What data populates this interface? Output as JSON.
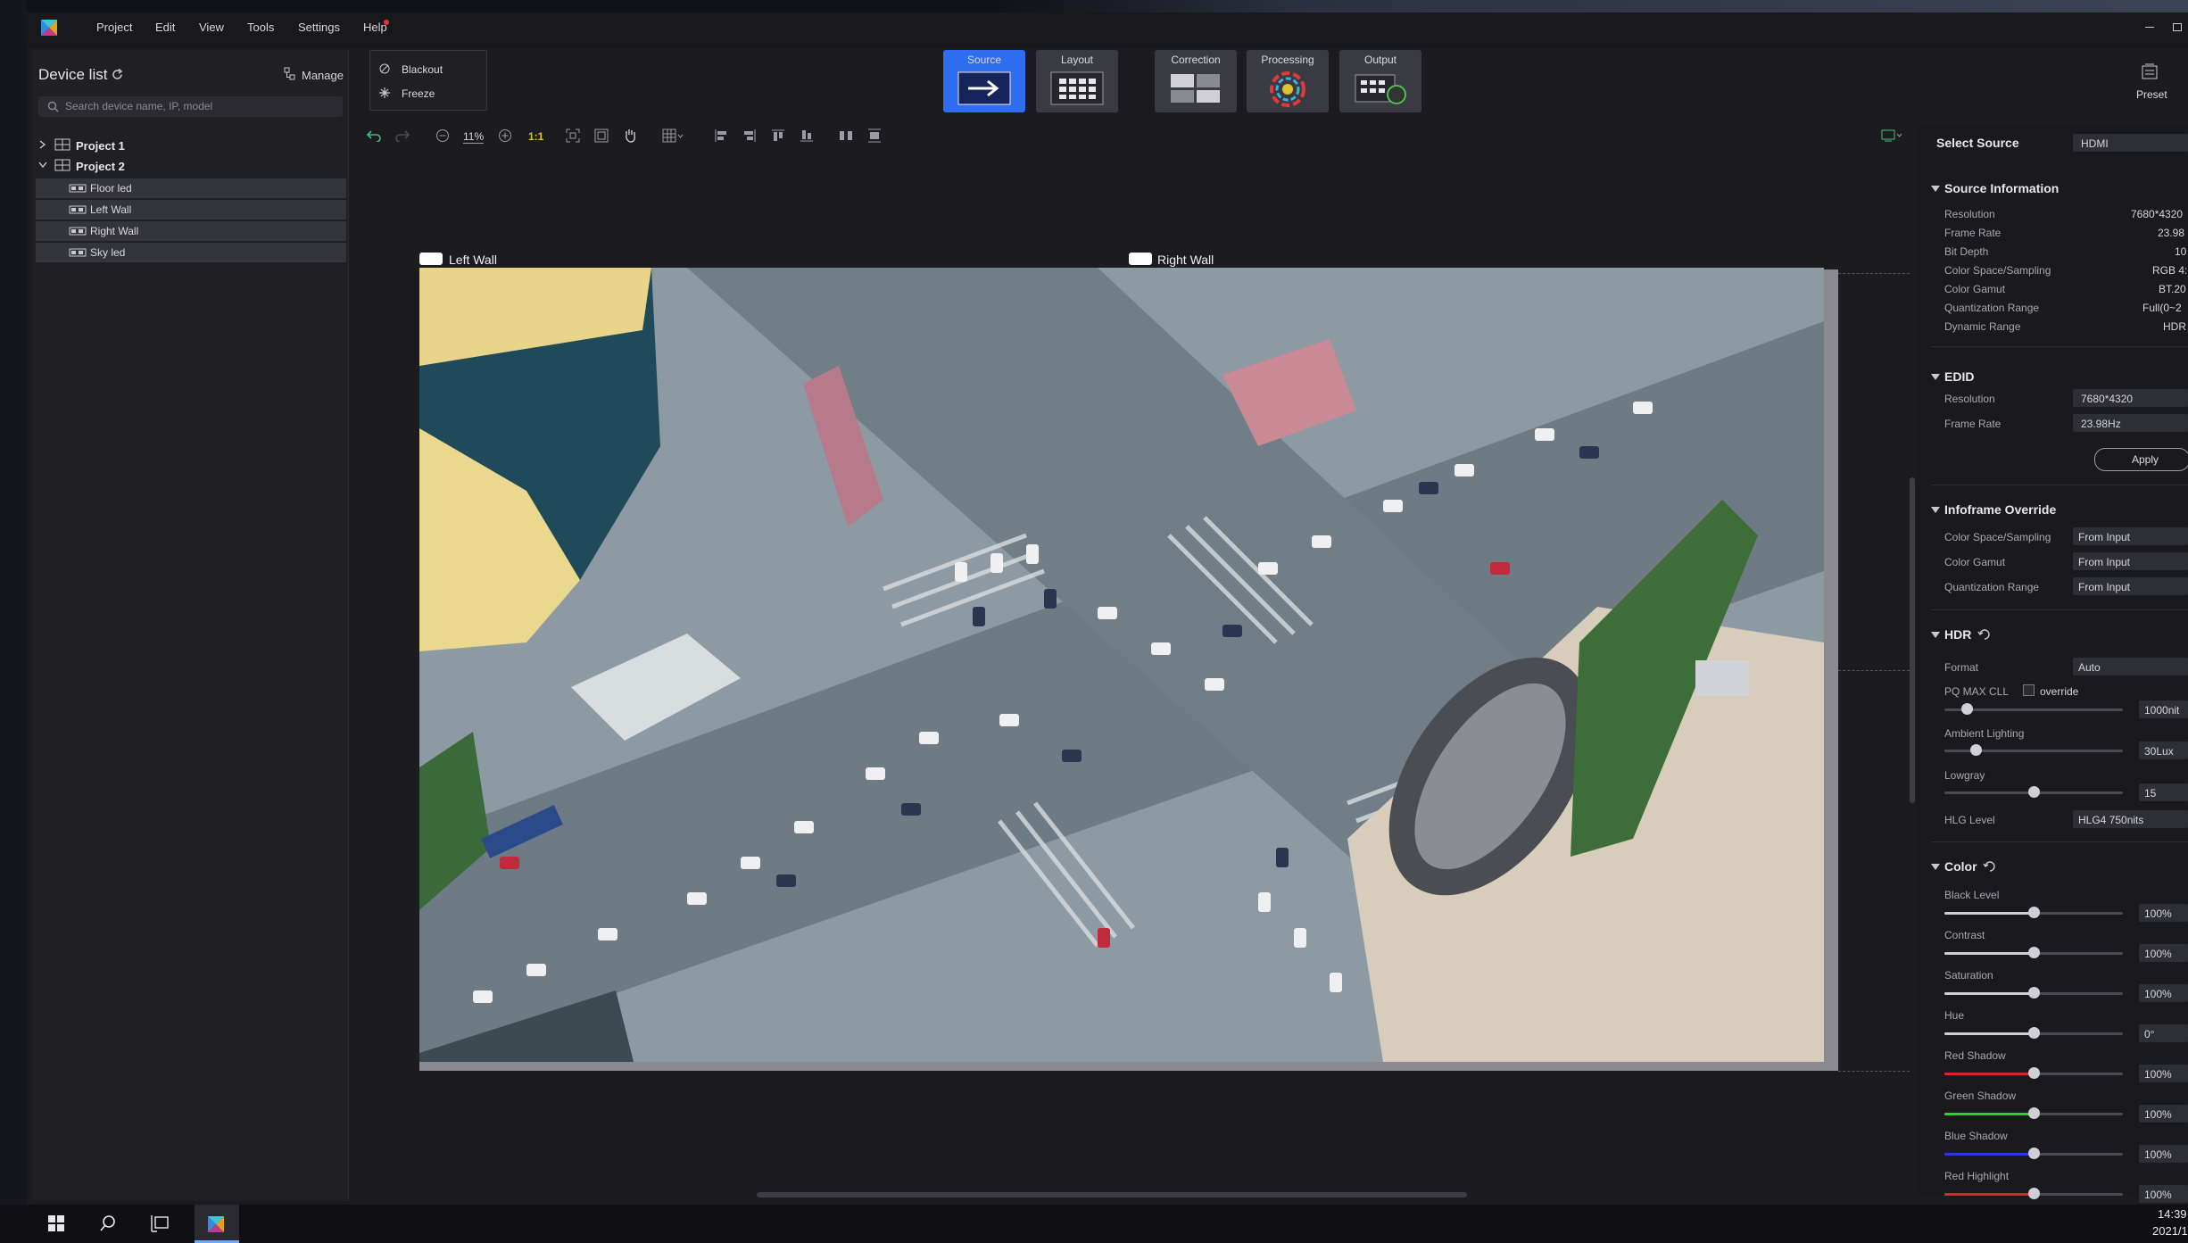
{
  "menu": [
    "Project",
    "Edit",
    "View",
    "Tools",
    "Settings",
    "Help"
  ],
  "device_list": {
    "title": "Device list",
    "manage": "Manage",
    "search_placeholder": "Search device name, IP, model",
    "projects": [
      {
        "label": "Project 1"
      },
      {
        "label": "Project 2",
        "devices": [
          "Floor led",
          "Left Wall",
          "Right Wall",
          "Sky led"
        ]
      }
    ]
  },
  "ops": {
    "blackout": "Blackout",
    "freeze": "Freeze"
  },
  "modes": [
    "Source",
    "Layout",
    "Correction",
    "Processing",
    "Output"
  ],
  "preset": "Preset",
  "canvas": {
    "zoom": "11%",
    "ratio": "1:1",
    "screens": [
      "Left Wall",
      "Right Wall"
    ]
  },
  "right_panel": {
    "select_source_label": "Select Source",
    "select_source_value": "HDMI",
    "source_info": {
      "title": "Source Information",
      "rows": [
        {
          "label": "Resolution",
          "value": "7680*4320"
        },
        {
          "label": "Frame Rate",
          "value": "23.98"
        },
        {
          "label": "Bit Depth",
          "value": "10"
        },
        {
          "label": "Color Space/Sampling",
          "value": "RGB 4:"
        },
        {
          "label": "Color Gamut",
          "value": "BT.20"
        },
        {
          "label": "Quantization Range",
          "value": "Full(0~2"
        },
        {
          "label": "Dynamic Range",
          "value": "HDR"
        }
      ]
    },
    "edid": {
      "title": "EDID",
      "rows": [
        {
          "label": "Resolution",
          "value": "7680*4320"
        },
        {
          "label": "Frame Rate",
          "value": "23.98Hz"
        }
      ],
      "apply": "Apply"
    },
    "infoframe": {
      "title": "Infoframe Override",
      "rows": [
        {
          "label": "Color Space/Sampling",
          "value": "From Input"
        },
        {
          "label": "Color Gamut",
          "value": "From Input"
        },
        {
          "label": "Quantization Range",
          "value": "From Input"
        }
      ]
    },
    "hdr": {
      "title": "HDR",
      "format_label": "Format",
      "format_value": "Auto",
      "pq_label": "PQ MAX CLL",
      "override": "override",
      "pq_value": "1000nit",
      "ambient_label": "Ambient Lighting",
      "ambient_value": "30Lux",
      "lowgray_label": "Lowgray",
      "lowgray_value": "15",
      "hlg_label": "HLG Level",
      "hlg_value": "HLG4 750nits"
    },
    "color": {
      "title": "Color",
      "rows": [
        {
          "label": "Black Level",
          "value": "100%",
          "color": "#cfcfd6"
        },
        {
          "label": "Contrast",
          "value": "100%",
          "color": "#cfcfd6"
        },
        {
          "label": "Saturation",
          "value": "100%",
          "color": "#cfcfd6"
        },
        {
          "label": "Hue",
          "value": "0°",
          "color": "#cfcfd6"
        },
        {
          "label": "Red Shadow",
          "value": "100%",
          "color": "#e0242a"
        },
        {
          "label": "Green Shadow",
          "value": "100%",
          "color": "#2ed12e"
        },
        {
          "label": "Blue Shadow",
          "value": "100%",
          "color": "#2b3bd8"
        },
        {
          "label": "Red Highlight",
          "value": "100%",
          "color": "#e0242a"
        }
      ]
    }
  },
  "taskbar": {
    "time": "14:39",
    "date": "2021/1"
  },
  "colors": {
    "accent": "#2f6df0",
    "panel": "#1f1f24"
  }
}
